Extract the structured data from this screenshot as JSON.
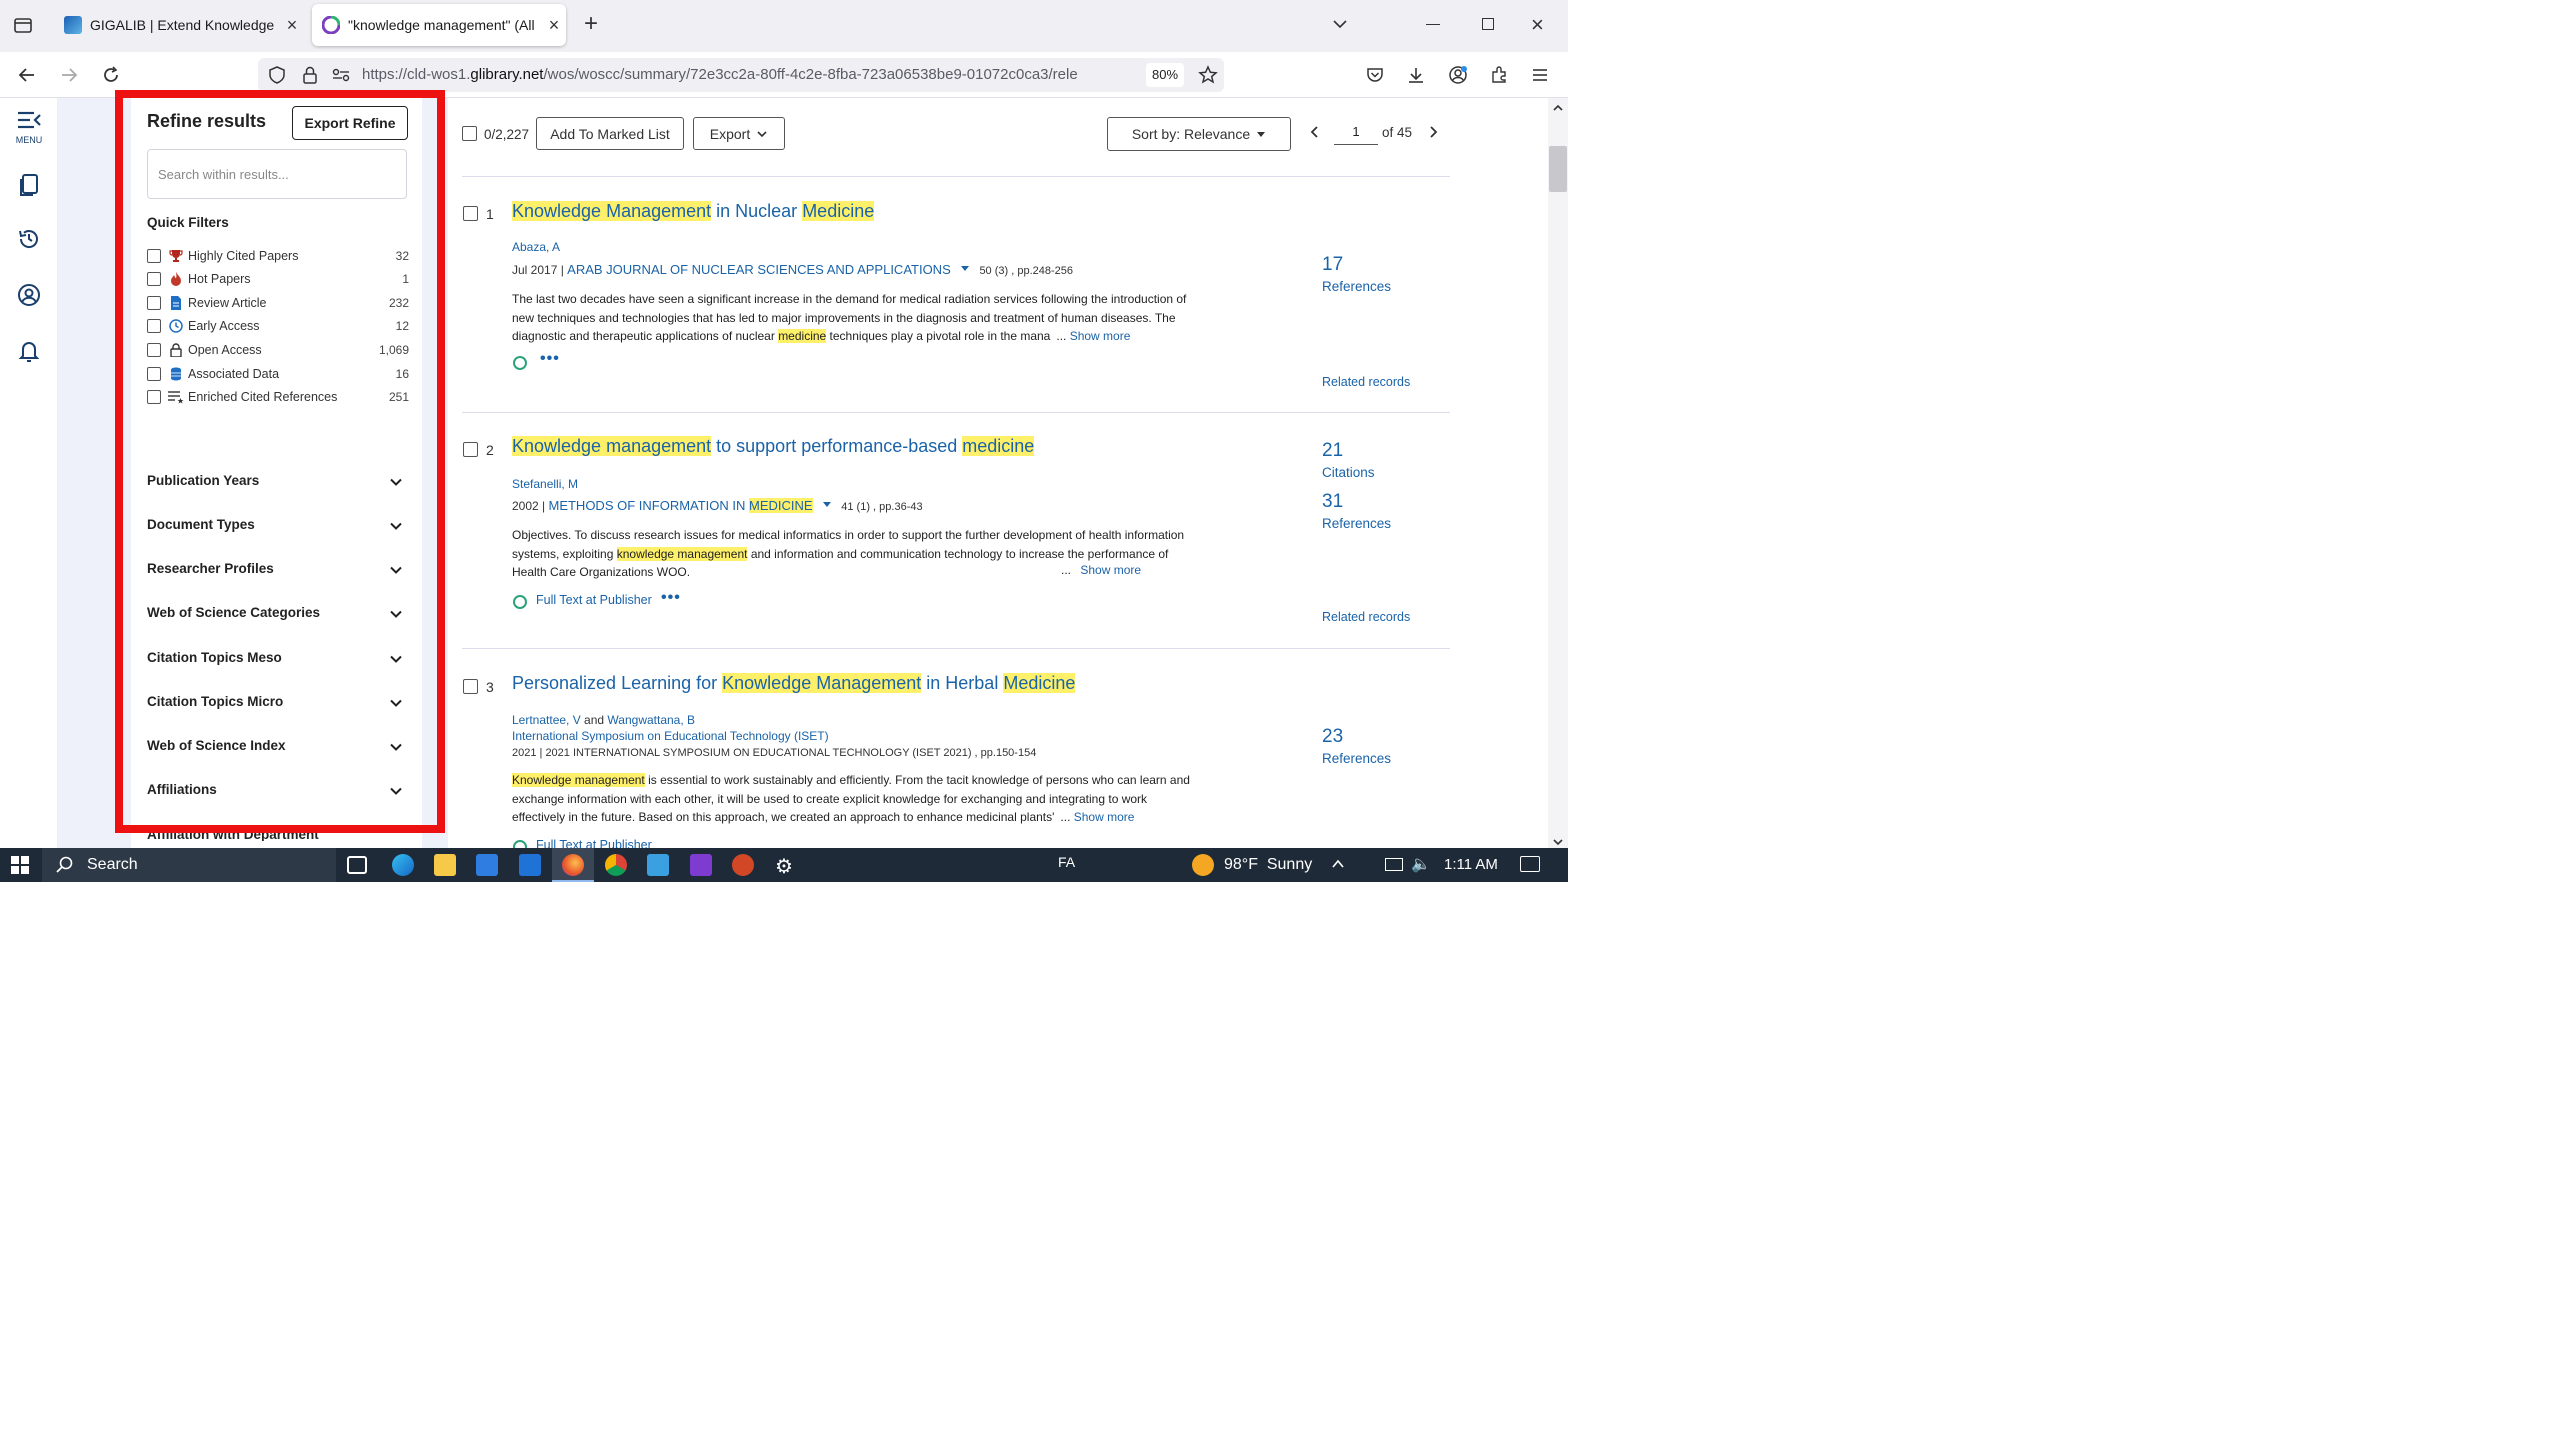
{
  "browser": {
    "tabs": [
      {
        "title": "GIGALIB | Extend Knowledge",
        "active": false
      },
      {
        "title": "\"knowledge management\" (All",
        "active": true
      }
    ],
    "url_prefix": "https://cld-wos1.",
    "url_domain": "glibrary.net",
    "url_rest": "/wos/woscc/summary/72e3cc2a-80ff-4c2e-8fba-723a06538be9-01072c0ca3/rele",
    "zoom": "80%"
  },
  "rail": {
    "menu_label": "MENU"
  },
  "refine": {
    "title": "Refine results",
    "export_button": "Export Refine",
    "search_placeholder": "Search within results...",
    "quick_filters_title": "Quick Filters",
    "quick_filters": [
      {
        "label": "Highly Cited Papers",
        "count": "32",
        "icon": "trophy-icon"
      },
      {
        "label": "Hot Papers",
        "count": "1",
        "icon": "flame-icon"
      },
      {
        "label": "Review Article",
        "count": "232",
        "icon": "document-icon"
      },
      {
        "label": "Early Access",
        "count": "12",
        "icon": "clock-icon"
      },
      {
        "label": "Open Access",
        "count": "1,069",
        "icon": "lock-open-icon"
      },
      {
        "label": "Associated Data",
        "count": "16",
        "icon": "database-icon"
      },
      {
        "label": "Enriched Cited References",
        "count": "251",
        "icon": "list-star-icon"
      }
    ],
    "sections": [
      "Publication Years",
      "Document Types",
      "Researcher Profiles",
      "Web of Science Categories",
      "Citation Topics Meso",
      "Citation Topics Micro",
      "Web of Science Index",
      "Affiliations",
      "Affiliation with Department"
    ]
  },
  "toolbar": {
    "selected_count": "0/2,227",
    "add_to_marked": "Add To Marked List",
    "export": "Export",
    "sort": "Sort by: Relevance",
    "page": "1",
    "page_of": "of 45"
  },
  "results": [
    {
      "num": "1",
      "title_parts": [
        {
          "text": "Knowledge Management",
          "hl": true
        },
        {
          "text": " in Nuclear ",
          "hl": false
        },
        {
          "text": "Medicine",
          "hl": true
        }
      ],
      "authors": "Abaza, A",
      "date": "Jul 2017 | ",
      "source": "ARAB JOURNAL OF NUCLEAR SCIENCES AND APPLICATIONS",
      "volume": "50 (3) , pp.248-256",
      "abstract_a": "The last two decades have seen a significant increase in the demand for medical radiation services following the introduction of new techniques and technologies that has led to major improvements in the diagnosis and treatment of human diseases. The diagnostic and therapeutic applications of nuclear ",
      "abstract_hl": "medicine",
      "abstract_b": " techniques play a pivotal role in the mana ... ",
      "show_more": "Show more",
      "stats": [
        {
          "value": "17",
          "label": "References"
        }
      ],
      "related": "Related records"
    },
    {
      "num": "2",
      "title_parts": [
        {
          "text": "Knowledge management",
          "hl": true
        },
        {
          "text": " to support performance-based ",
          "hl": false
        },
        {
          "text": "medicine",
          "hl": true
        }
      ],
      "authors": "Stefanelli, M",
      "date": "2002 | ",
      "source_a": "METHODS OF INFORMATION IN ",
      "source_hl": "MEDICINE",
      "volume": "41 (1) , pp.36-43",
      "abstract_a": "Objectives. To discuss research issues for medical informatics in order to support the further development of health information systems, exploiting ",
      "abstract_hl": "knowledge management",
      "abstract_b": " and information and communication technology to increase the performance of Health Care Organizations WOO.",
      "ellipsis": "...",
      "show_more": "Show more",
      "full_text": "Full Text at Publisher",
      "stats": [
        {
          "value": "21",
          "label": "Citations"
        },
        {
          "value": "31",
          "label": "References"
        }
      ],
      "related": "Related records"
    },
    {
      "num": "3",
      "title_parts": [
        {
          "text": "Personalized Learning for ",
          "hl": false
        },
        {
          "text": "Knowledge Management",
          "hl": true
        },
        {
          "text": " in Herbal ",
          "hl": false
        },
        {
          "text": "Medicine",
          "hl": true
        }
      ],
      "author_1": "Lertnattee, V",
      "author_and": " and ",
      "author_2": "Wangwattana, B",
      "conference": "International Symposium on Educational Technology (ISET)",
      "meta": "2021 | 2021 INTERNATIONAL SYMPOSIUM ON EDUCATIONAL TECHNOLOGY (ISET 2021) , pp.150-154",
      "abstract_hl": "Knowledge management",
      "abstract_b": " is essential to work sustainably and efficiently. From the tacit knowledge of persons who can learn and exchange information with each other, it will be used to create explicit knowledge for exchanging and integrating to work effectively in the future. Based on this approach, we created an approach to enhance medicinal plants' ... ",
      "show_more": "Show more",
      "full_text": "Full Text at Publisher",
      "stats": [
        {
          "value": "23",
          "label": "References"
        }
      ]
    }
  ],
  "taskbar": {
    "search": "Search",
    "lang": "FA",
    "weather": "98°F  Sunny",
    "time": "1:11 AM"
  }
}
